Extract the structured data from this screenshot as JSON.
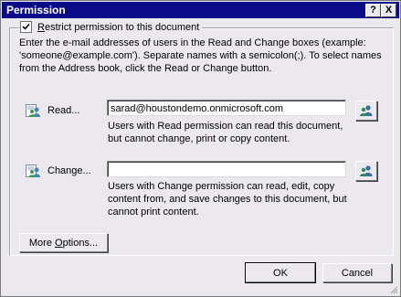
{
  "window": {
    "title": "Permission",
    "help_label": "?",
    "close_label": "X"
  },
  "restrict": {
    "checked": true,
    "label_accel": "R",
    "label_rest": "estrict permission to this document"
  },
  "instructions": "Enter the e-mail addresses of users in the Read and Change boxes (example: 'someone@example.com'). Separate names with a semicolon(;). To select names from the Address book, click the Read or Change button.",
  "read": {
    "label": "Read...",
    "value": "sarad@houstondemo.onmicrosoft.com",
    "description": "Users with Read permission can read this document, but cannot change, print or copy content."
  },
  "change": {
    "label": "Change...",
    "value": "",
    "description": "Users with Change permission can read, edit, copy content from, and save changes to this document, but cannot print content."
  },
  "buttons": {
    "more_options_pre": "More ",
    "more_options_accel": "O",
    "more_options_post": "ptions...",
    "ok": "OK",
    "cancel": "Cancel"
  },
  "icons": {
    "read_icon": "people-icon",
    "change_icon": "people-icon",
    "address_book": "address-book-icon"
  }
}
